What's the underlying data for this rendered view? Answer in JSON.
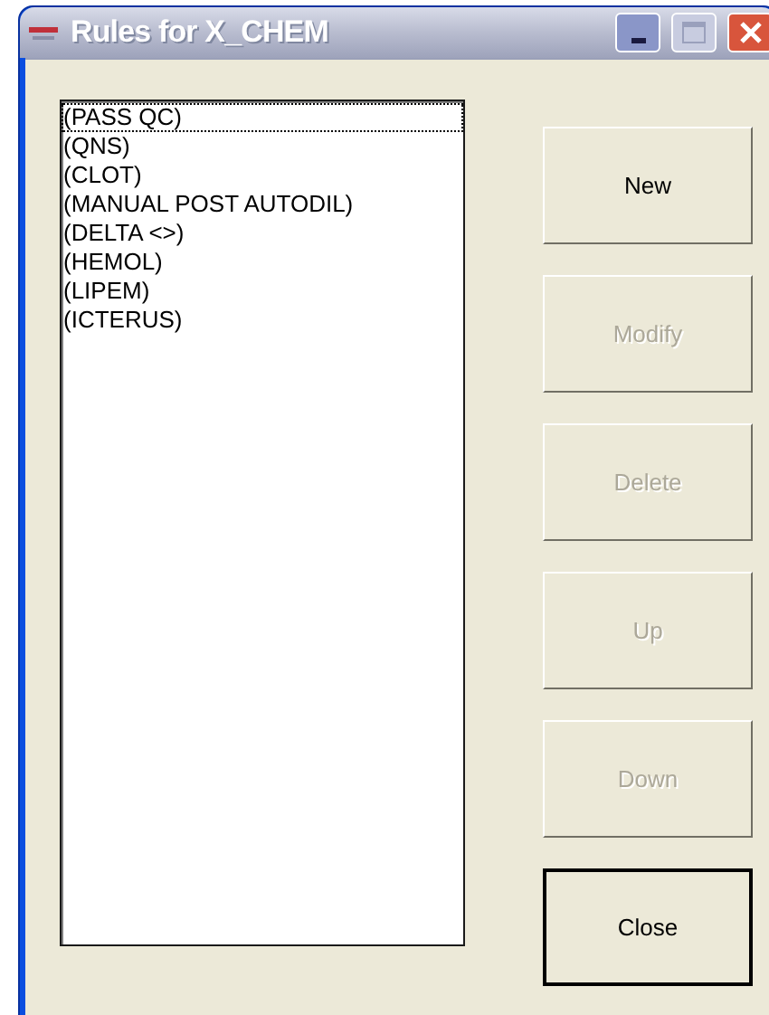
{
  "window": {
    "title": "Rules for X_CHEM"
  },
  "rules": [
    {
      "label": "(PASS QC)",
      "focused": true
    },
    {
      "label": "(QNS)",
      "focused": false
    },
    {
      "label": "(CLOT)",
      "focused": false
    },
    {
      "label": "(MANUAL POST AUTODIL)",
      "focused": false
    },
    {
      "label": "(DELTA <>)",
      "focused": false
    },
    {
      "label": "(HEMOL)",
      "focused": false
    },
    {
      "label": "(LIPEM)",
      "focused": false
    },
    {
      "label": "(ICTERUS)",
      "focused": false
    }
  ],
  "buttons": [
    {
      "label": "New",
      "disabled": false,
      "default": false
    },
    {
      "label": "Modify",
      "disabled": true,
      "default": false
    },
    {
      "label": "Delete",
      "disabled": true,
      "default": false
    },
    {
      "label": "Up",
      "disabled": true,
      "default": false
    },
    {
      "label": "Down",
      "disabled": true,
      "default": false
    },
    {
      "label": "Close",
      "disabled": false,
      "default": true
    }
  ]
}
